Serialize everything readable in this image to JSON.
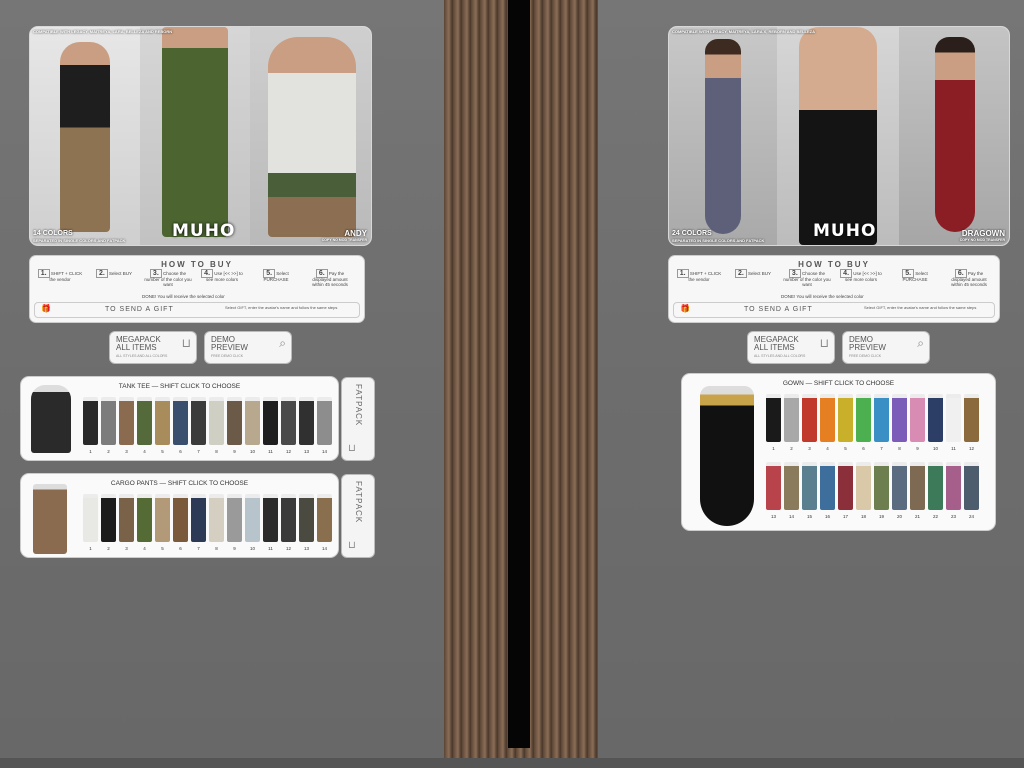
{
  "left_vendor": {
    "ad": {
      "header": "COMPATIBLE WITH LEGACY, MAITREYA, LARA, BELLEZA AND REBORN",
      "colors_label": "14 COLORS",
      "separated_note": "SEPARATED IN SINGLE COLORS AND FATPACK",
      "brand": "MUHO",
      "product": "ANDY",
      "product_note": "COPY NO MOD TRANSFER"
    },
    "how_to_buy": {
      "title": "HOW TO BUY",
      "steps": [
        {
          "num": "1.",
          "text": "SHIFT + CLICK the vendor"
        },
        {
          "num": "2.",
          "text": "Select BUY"
        },
        {
          "num": "3.",
          "text": "Choose the number of the color you want"
        },
        {
          "num": "4.",
          "text": "Use [<< >>] to see more colors"
        },
        {
          "num": "5.",
          "text": "Select PURCHASE"
        },
        {
          "num": "6.",
          "text": "Pay the displayed amount within 45 seconds"
        }
      ],
      "done": "DONE! You will receive the selected color",
      "gift_label": "TO SEND A GIFT",
      "gift_text": "Select GIFT, enter the avatar's name and follow the same steps"
    },
    "megapack": {
      "label1": "MEGAPACK",
      "label2": "ALL ITEMS",
      "sub": "ALL STYLES AND ALL COLORS"
    },
    "demo": {
      "label1": "DEMO",
      "label2": "PREVIEW",
      "sub": "FREE DEMO CLICK"
    },
    "tank": {
      "title": "TANK TEE  —  SHIFT CLICK TO CHOOSE",
      "numbers": [
        "1",
        "2",
        "3",
        "4",
        "5",
        "6",
        "7",
        "8",
        "9",
        "10",
        "11",
        "12",
        "13",
        "14"
      ],
      "colors": [
        "#2a2a2a",
        "#7c7c7c",
        "#8b6b4f",
        "#556a3a",
        "#a88c5c",
        "#3a4e6e",
        "#3b3b3b",
        "#cfcfc4",
        "#6b5a47",
        "#b8a98e",
        "#1f1f1f",
        "#4a4a4a",
        "#303030",
        "#8d8d8d"
      ]
    },
    "pants": {
      "title": "CARGO PANTS  —  SHIFT CLICK TO CHOOSE",
      "numbers": [
        "1",
        "2",
        "3",
        "4",
        "5",
        "6",
        "7",
        "8",
        "9",
        "10",
        "11",
        "12",
        "13",
        "14"
      ],
      "colors": [
        "#e8e8e4",
        "#1c1c1c",
        "#7a6248",
        "#556b35",
        "#b29a78",
        "#7b5a3c",
        "#2d3a55",
        "#d5cfc2",
        "#9a9a9a",
        "#b8c4cc",
        "#2c2c2c",
        "#3a3a3a",
        "#4a4a40",
        "#8a6f4f"
      ]
    },
    "fatpack_label": "FATPACK"
  },
  "right_vendor": {
    "ad": {
      "header": "COMPATIBLE WITH LEGACY, MAITREYA, LARA X, REBORN AND BELLEZA",
      "colors_label": "24 COLORS",
      "separated_note": "SEPARATED IN SINGLE COLORS AND FATPACK",
      "brand": "MUHO",
      "product": "DRAGOWN",
      "product_note": "COPY NO MOD TRANSFER"
    },
    "how_to_buy": {
      "title": "HOW TO BUY",
      "steps": [
        {
          "num": "1.",
          "text": "SHIFT + CLICK the vendor"
        },
        {
          "num": "2.",
          "text": "Select BUY"
        },
        {
          "num": "3.",
          "text": "Choose the number of the color you want"
        },
        {
          "num": "4.",
          "text": "Use [<< >>] to see more colors"
        },
        {
          "num": "5.",
          "text": "Select PURCHASE"
        },
        {
          "num": "6.",
          "text": "Pay the displayed amount within 45 seconds"
        }
      ],
      "done": "DONE! You will receive the selected color",
      "gift_label": "TO SEND A GIFT",
      "gift_text": "Select GIFT, enter the avatar's name and follow the same steps"
    },
    "megapack": {
      "label1": "MEGAPACK",
      "label2": "ALL ITEMS",
      "sub": "ALL STYLES AND ALL COLORS"
    },
    "demo": {
      "label1": "DEMO",
      "label2": "PREVIEW",
      "sub": "FREE DEMO CLICK"
    },
    "gown": {
      "title": "GOWN  —  SHIFT CLICK TO CHOOSE",
      "numbers_row1": [
        "1",
        "2",
        "3",
        "4",
        "5",
        "6",
        "7",
        "8",
        "9",
        "10",
        "11",
        "12"
      ],
      "numbers_row2": [
        "13",
        "14",
        "15",
        "16",
        "17",
        "18",
        "19",
        "20",
        "21",
        "22",
        "23",
        "24"
      ],
      "colors_row1": [
        "#1a1a1a",
        "#a8a8a8",
        "#c0392b",
        "#e67e22",
        "#c9b02a",
        "#4caf50",
        "#3a8fc4",
        "#7b5cb8",
        "#d98cb3",
        "#2c3e66",
        "#f0f0f0",
        "#8b6a3e"
      ],
      "colors_row2": [
        "#b8434a",
        "#8a7b5c",
        "#5a7f8f",
        "#3e6e9c",
        "#8b2f3a",
        "#d9c9a8",
        "#6d7f4f",
        "#5b6b80",
        "#7e6a52",
        "#3d7a5a",
        "#a65e8a",
        "#4d5d6d"
      ]
    }
  }
}
